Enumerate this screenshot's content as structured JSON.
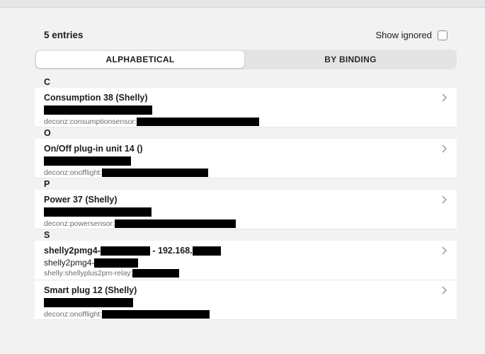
{
  "header": {
    "entry_count": "5 entries",
    "show_ignored_label": "Show ignored",
    "show_ignored_checked": false
  },
  "tabs": [
    {
      "label": "ALPHABETICAL",
      "active": true
    },
    {
      "label": "BY BINDING",
      "active": false
    }
  ],
  "sections": [
    {
      "letter": "C",
      "items": [
        {
          "title": "Consumption 38 (Shelly)",
          "subtitle": "",
          "detail": "deconz:consumptionsensor:"
        }
      ]
    },
    {
      "letter": "O",
      "items": [
        {
          "title": "On/Off plug-in unit 14 ()",
          "subtitle": "",
          "detail": "deconz:onofflight:"
        }
      ]
    },
    {
      "letter": "P",
      "items": [
        {
          "title": "Power 37 (Shelly)",
          "subtitle": "",
          "detail": "deconz:powersensor:"
        }
      ]
    },
    {
      "letter": "S",
      "items": [
        {
          "title": "shelly2pmg4-",
          "title_suffix": " - 192.168.",
          "subtitle": "shelly2pmg4-",
          "detail": "shelly:shellyplus2pm-relay:"
        },
        {
          "title": "Smart plug 12 (Shelly)",
          "subtitle": "",
          "detail": "deconz:onofflight:"
        }
      ]
    }
  ],
  "icons": {
    "row_action": "chevron-right-icon"
  },
  "colors": {
    "background": "#f2f2f3",
    "card": "#ffffff",
    "redaction": "#000000"
  }
}
